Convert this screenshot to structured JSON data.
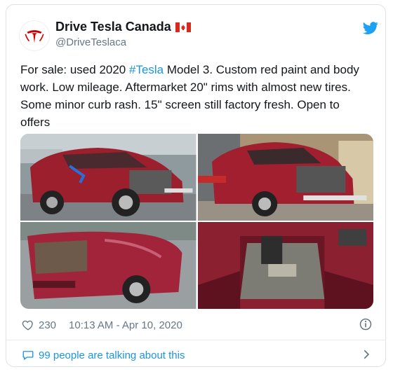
{
  "account": {
    "name": "Drive Tesla Canada",
    "handle": "@DriveTeslaca"
  },
  "tweet": {
    "text_before": "For sale: used 2020 ",
    "hashtag": "#Tesla",
    "text_after": " Model 3. Custom red paint and body work. Low mileage. Aftermarket 20\" rims with almost new tires. Some minor curb rash. 15\" screen still factory fresh. Open to offers"
  },
  "meta": {
    "likes": "230",
    "timestamp": "10:13 AM - Apr 10, 2020"
  },
  "conversation": {
    "label": "99 people are talking about this"
  },
  "colors": {
    "accent": "#1b95e0",
    "tesla_red": "#cc0000",
    "car_red": "#b3263a",
    "muted": "#657786"
  },
  "icons": [
    "tesla-logo-icon",
    "canada-flag-icon",
    "twitter-bird-icon",
    "heart-icon",
    "info-icon",
    "speech-bubble-icon",
    "chevron-right-icon"
  ]
}
